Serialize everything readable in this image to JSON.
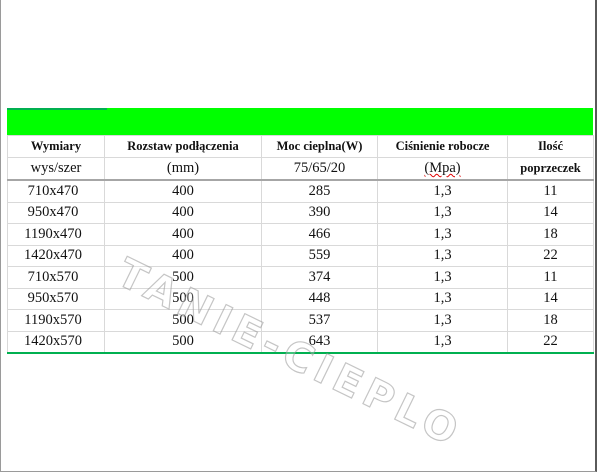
{
  "table": {
    "header_row1": [
      "Wymiary",
      "Rozstaw podłączenia",
      "Moc cieplna(W)",
      "Ciśnienie robocze",
      "Ilość"
    ],
    "header_row2": [
      "wys/szer",
      "(mm)",
      "75/65/20",
      "(Mpa)",
      "poprzeczek"
    ],
    "rows": [
      [
        "710x470",
        "400",
        "285",
        "1,3",
        "11"
      ],
      [
        "950x470",
        "400",
        "390",
        "1,3",
        "14"
      ],
      [
        "1190x470",
        "400",
        "466",
        "1,3",
        "18"
      ],
      [
        "1420x470",
        "400",
        "559",
        "1,3",
        "22"
      ],
      [
        "710x570",
        "500",
        "374",
        "1,3",
        "11"
      ],
      [
        "950x570",
        "500",
        "448",
        "1,3",
        "14"
      ],
      [
        "1190x570",
        "500",
        "537",
        "1,3",
        "18"
      ],
      [
        "1420x570",
        "500",
        "643",
        "1,3",
        "22"
      ]
    ]
  },
  "watermark": "TANIE-CIEPLO",
  "colors": {
    "header_bar": "#00ff00",
    "bottom_rule": "#00b050"
  }
}
